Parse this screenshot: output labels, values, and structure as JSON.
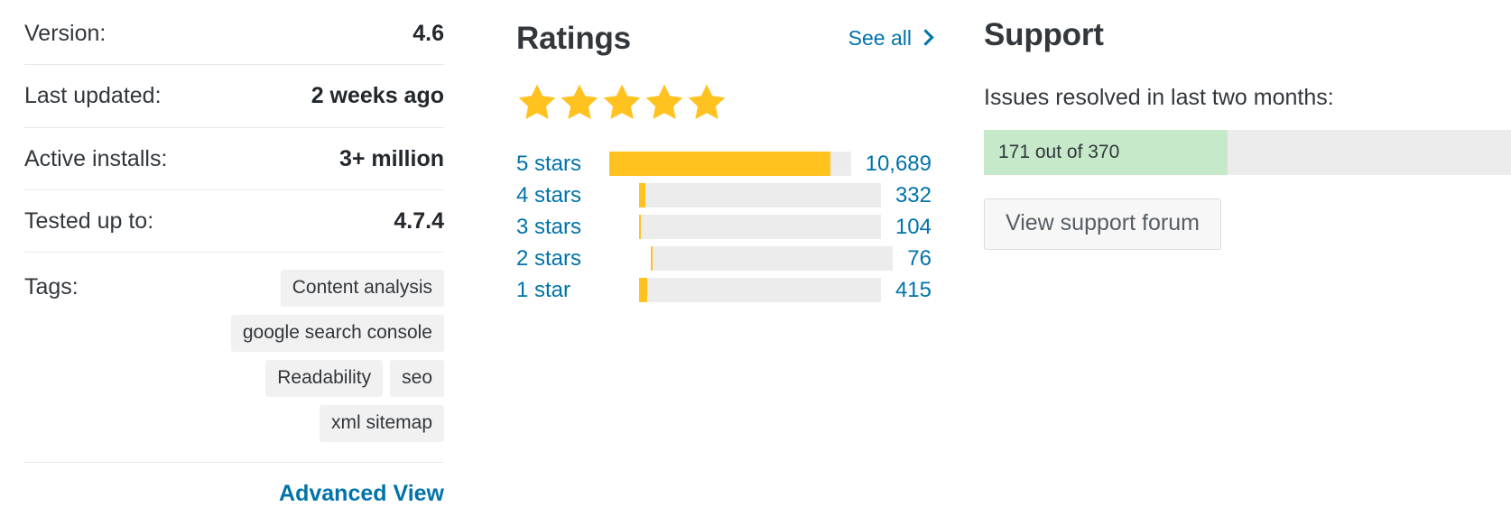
{
  "meta": {
    "rows": [
      {
        "label": "Version:",
        "value": "4.6"
      },
      {
        "label": "Last updated:",
        "value": "2 weeks ago"
      },
      {
        "label": "Active installs:",
        "value": "3+ million"
      },
      {
        "label": "Tested up to:",
        "value": "4.7.4"
      }
    ],
    "tags_label": "Tags:",
    "tags": [
      "Content analysis",
      "google search console",
      "Readability",
      "seo",
      "xml sitemap"
    ],
    "advanced_view": "Advanced View"
  },
  "ratings": {
    "title": "Ratings",
    "see_all": "See all",
    "see_all_icon": "chevron-right-icon",
    "star_icon": "star-filled-icon",
    "stars_filled": 5,
    "stars_total": 5,
    "star_color": "#ffc21f",
    "link_color": "#0073aa",
    "track_color": "#ececec"
  },
  "support": {
    "title": "Support",
    "subtitle": "Issues resolved in last two months:",
    "progress_text": "171 out of 370",
    "button_label": "View support forum",
    "fill_color": "#c6e9c9",
    "track_color": "#ececec"
  },
  "chart_data": {
    "type": "bar",
    "title": "Ratings",
    "orientation": "horizontal",
    "categories": [
      "5 stars",
      "4 stars",
      "3 stars",
      "2 stars",
      "1 star"
    ],
    "values": [
      10689,
      332,
      104,
      76,
      415
    ],
    "value_labels": [
      "10,689",
      "332",
      "104",
      "76",
      "415"
    ],
    "bar_percents": [
      91.5,
      2.8,
      0.9,
      0.7,
      3.5
    ],
    "xlabel": "",
    "ylabel": "",
    "xlim": [
      0,
      11680
    ],
    "grid": false,
    "legend": false,
    "bar_color": "#ffc21f",
    "track_color": "#ececec"
  }
}
